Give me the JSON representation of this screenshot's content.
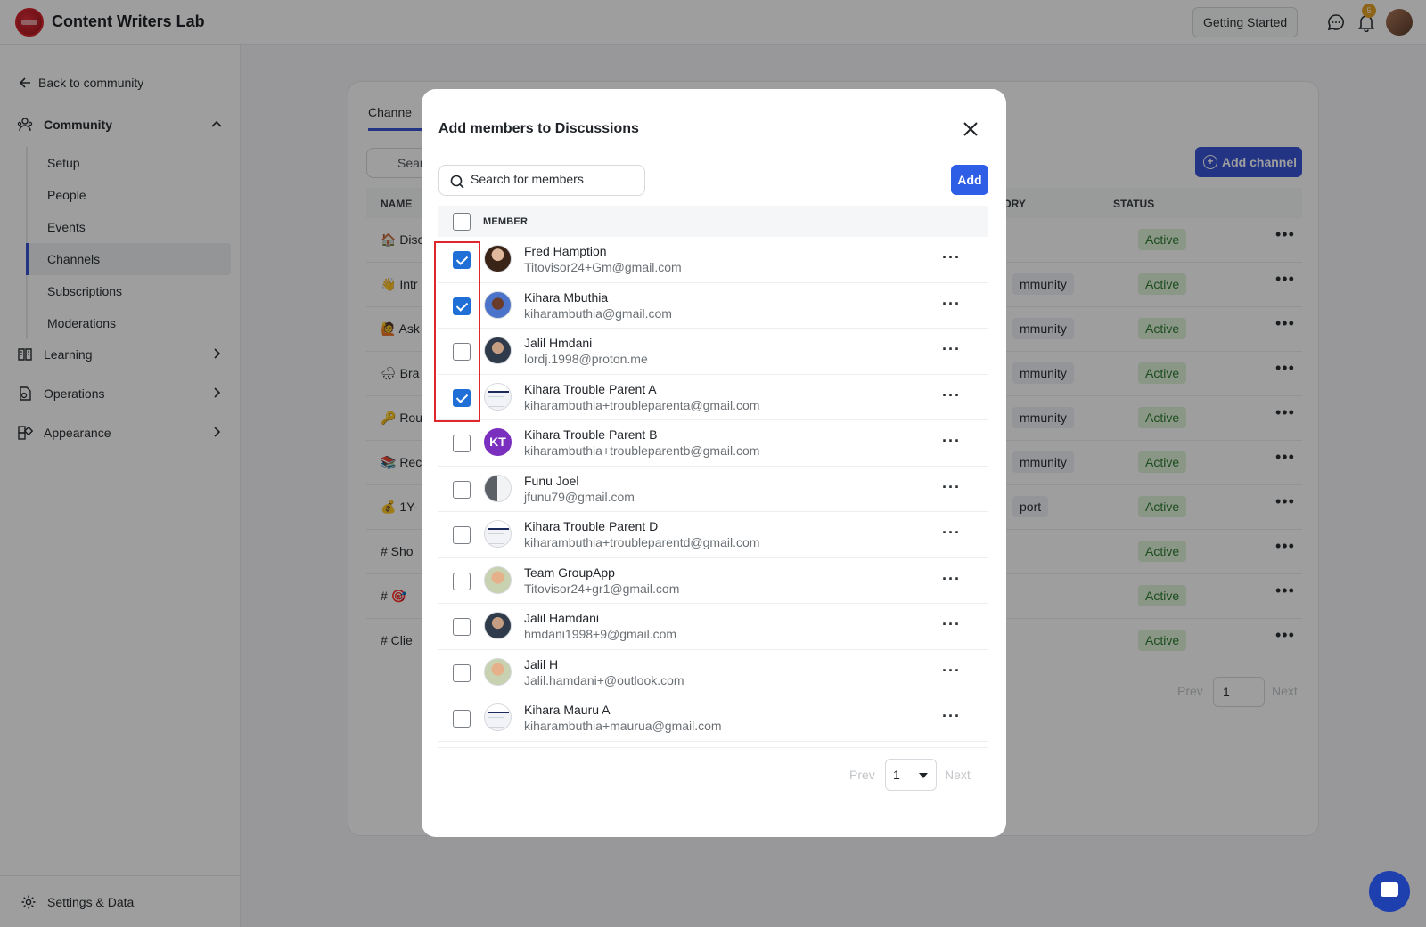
{
  "app": {
    "title": "Content Writers Lab"
  },
  "topbar": {
    "getting_started": "Getting Started",
    "notification_count": "5"
  },
  "sidebar": {
    "back_link": "Back to community",
    "community_label": "Community",
    "sub_items": [
      "Setup",
      "People",
      "Events",
      "Channels",
      "Subscriptions",
      "Moderations"
    ],
    "active_item": "Channels",
    "learning_label": "Learning",
    "operations_label": "Operations",
    "appearance_label": "Appearance",
    "settings_label": "Settings & Data"
  },
  "background": {
    "tab_label": "Channe",
    "search_placeholder": "Sear",
    "add_channel": "Add channel",
    "headers": {
      "name": "NAME",
      "category": "GORY",
      "status": "STATUS"
    },
    "rows": [
      {
        "name": "🏠 Disc",
        "category": "",
        "status": "Active"
      },
      {
        "name": "👋 Intr",
        "category": "mmunity",
        "status": "Active"
      },
      {
        "name": "🙋 Ask",
        "category": "mmunity",
        "status": "Active"
      },
      {
        "name": "🌧 Bra",
        "category": "mmunity",
        "status": "Active"
      },
      {
        "name": "🔑 Rou",
        "category": "mmunity",
        "status": "Active"
      },
      {
        "name": "📚 Rec",
        "category": "mmunity",
        "status": "Active"
      },
      {
        "name": "💰 1Y-",
        "category": "port",
        "status": "Active"
      },
      {
        "name": "# Sho",
        "category": "",
        "status": "Active"
      },
      {
        "name": "# 🎯",
        "category": "",
        "status": "Active"
      },
      {
        "name": "# Clie",
        "category": "",
        "status": "Active"
      }
    ],
    "pager": {
      "prev": "Prev",
      "page": "1",
      "next": "Next"
    }
  },
  "modal": {
    "title": "Add members to Discussions",
    "search_placeholder": "Search for members",
    "add_button": "Add",
    "column_header": "MEMBER",
    "members": [
      {
        "name": "Fred Hamption",
        "email": "Titovisor24+Gm@gmail.com",
        "checked": true,
        "avatar": "photo-dark"
      },
      {
        "name": "Kihara Mbuthia",
        "email": "kiharambuthia@gmail.com",
        "checked": true,
        "avatar": "photo-red"
      },
      {
        "name": "Jalil Hmdani",
        "email": "lordj.1998@proton.me",
        "checked": false,
        "avatar": "photo-man"
      },
      {
        "name": "Kihara Trouble Parent A",
        "email": "kiharambuthia+troubleparenta@gmail.com",
        "checked": true,
        "avatar": "screen"
      },
      {
        "name": "Kihara Trouble Parent B",
        "email": "kiharambuthia+troubleparentb@gmail.com",
        "checked": false,
        "avatar": "kt",
        "initials": "KT"
      },
      {
        "name": "Funu Joel",
        "email": "jfunu79@gmail.com",
        "checked": false,
        "avatar": "half"
      },
      {
        "name": "Kihara Trouble Parent D",
        "email": "kiharambuthia+troubleparentd@gmail.com",
        "checked": false,
        "avatar": "screen"
      },
      {
        "name": "Team GroupApp",
        "email": "Titovisor24+gr1@gmail.com",
        "checked": false,
        "avatar": "warm"
      },
      {
        "name": "Jalil Hamdani",
        "email": "hmdani1998+9@gmail.com",
        "checked": false,
        "avatar": "photo-man"
      },
      {
        "name": "Jalil H",
        "email": "Jalil.hamdani+@outlook.com",
        "checked": false,
        "avatar": "warm"
      },
      {
        "name": "Kihara Mauru A",
        "email": "kiharambuthia+maurua@gmail.com",
        "checked": false,
        "avatar": "screen"
      }
    ],
    "pager": {
      "prev": "Prev",
      "page": "1",
      "next": "Next"
    }
  },
  "colors": {
    "accent": "#2f5ee6",
    "checkbox": "#1f6fd6",
    "highlight": "#e0262d",
    "status_bg": "#dff2d9"
  }
}
